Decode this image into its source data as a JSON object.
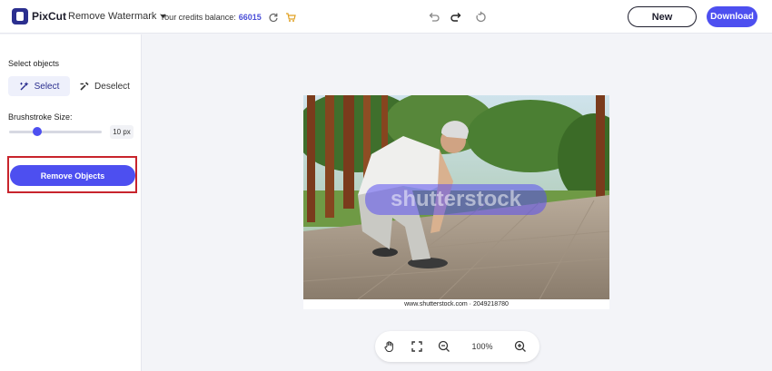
{
  "header": {
    "brand": "PixCut",
    "tool_menu": "Remove Watermark",
    "credits_label": "Your credits balance:",
    "credits_value": "66015",
    "new_label": "New",
    "download_label": "Download"
  },
  "icons": {
    "undo": "undo-icon",
    "redo": "redo-icon",
    "reset": "reset-icon",
    "refresh": "refresh-icon",
    "cart": "cart-icon",
    "hand": "hand-icon",
    "fit": "fit-screen-icon",
    "zoom_out": "zoom-out-icon",
    "zoom_in": "zoom-in-icon"
  },
  "sidebar": {
    "section_title": "Select objects",
    "select_label": "Select",
    "deselect_label": "Deselect",
    "brush_label": "Brushstroke Size:",
    "brush_value": "10 px",
    "brush_level": 0.3,
    "remove_label": "Remove Objects"
  },
  "canvas": {
    "watermark_text": "shutterstock",
    "caption": "www.shutterstock.com · 2049218780"
  },
  "zoom": {
    "value": "100%"
  },
  "colors": {
    "accent": "#4d4ff0",
    "highlight_frame": "#c8242c",
    "brush_overlay": "#5a4ff0"
  }
}
